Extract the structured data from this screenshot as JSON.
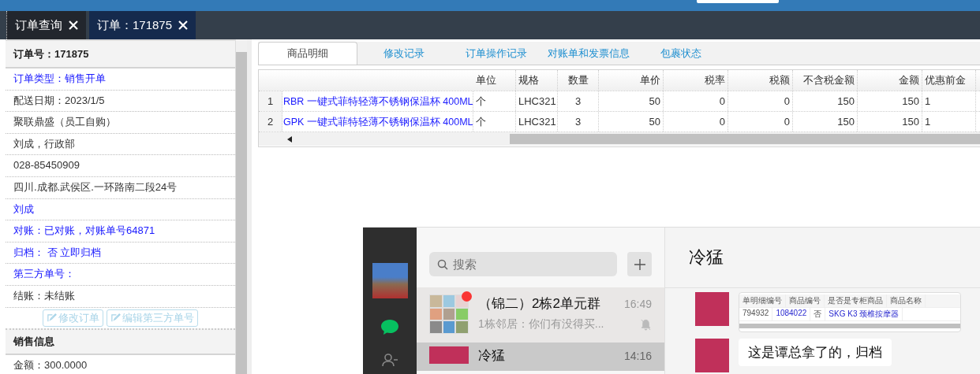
{
  "top_tabs": [
    {
      "label": "订单查询",
      "selected": false
    },
    {
      "label": "订单：171875",
      "selected": true
    }
  ],
  "left_panel": {
    "title": "订单号：171875",
    "rows": [
      {
        "text": "订单类型：销售开单",
        "kind": "link"
      },
      {
        "text": "配送日期：2023/1/5",
        "kind": "text"
      },
      {
        "text": "聚联鼎盛（员工自购）",
        "kind": "text"
      },
      {
        "text": "刘成，行政部",
        "kind": "text"
      },
      {
        "text": "028-85450909",
        "kind": "text"
      },
      {
        "text": "四川.成都.武侯区.一环路南二段24号",
        "kind": "text"
      },
      {
        "text": "刘成",
        "kind": "link"
      },
      {
        "text": "对账：已对账，对账单号64871",
        "kind": "link"
      },
      {
        "text": "归档： 否 立即归档",
        "kind": "link"
      },
      {
        "text": "第三方单号：",
        "kind": "link"
      },
      {
        "text": "结账：未结账",
        "kind": "text"
      }
    ],
    "buttons": [
      {
        "label": "修改订单",
        "disabled": true
      },
      {
        "label": "编辑第三方单号",
        "disabled": true
      }
    ],
    "section": {
      "title": "销售信息",
      "rows": [
        {
          "text": "金额：300.0000",
          "kind": "text"
        }
      ]
    }
  },
  "detail_tabs": [
    {
      "label": "商品明细",
      "selected": true
    },
    {
      "label": "修改记录",
      "selected": false
    },
    {
      "label": "订单操作记录",
      "selected": false
    },
    {
      "label": "对账单和发票信息",
      "selected": false
    },
    {
      "label": "包裹状态",
      "selected": false
    }
  ],
  "table": {
    "columns": [
      "单位",
      "规格",
      "数量",
      "单价",
      "税率",
      "税额",
      "不含税金额",
      "金额",
      "优惠前金"
    ],
    "rows": [
      {
        "number": "1",
        "name": "RBR 一键式菲特轻薄不锈钢保温杯 400ML",
        "cells": [
          "个",
          "LHC321",
          "3",
          "50",
          "0",
          "0",
          "150",
          "150",
          "1"
        ]
      },
      {
        "number": "2",
        "name": "GPK 一键式菲特轻薄不锈钢保温杯 400ML",
        "cells": [
          "个",
          "LHC321",
          "3",
          "50",
          "0",
          "0",
          "150",
          "150",
          "1"
        ]
      }
    ]
  },
  "chat": {
    "search": {
      "placeholder": "搜索"
    },
    "conversations": [
      {
        "name": "（锦二）2栋2单元群",
        "time": "16:49",
        "preview": "1栋邻居：你们有没得买...",
        "unread": true,
        "muted": true,
        "selected": false,
        "kind": "group"
      },
      {
        "name": "冷猛",
        "time": "14:16",
        "unread": false,
        "muted": false,
        "selected": true,
        "kind": "person"
      }
    ],
    "title": "冷猛",
    "messages": [
      {
        "kind": "image",
        "columns": [
          "单明细编号",
          "商品编号",
          "是否是专柜商品",
          "商品名称"
        ],
        "row": [
          "794932",
          "1084022",
          "否",
          "SKG K3 颈椎按摩器"
        ]
      },
      {
        "kind": "text",
        "text": "这是谭总拿了的，归档"
      }
    ]
  }
}
